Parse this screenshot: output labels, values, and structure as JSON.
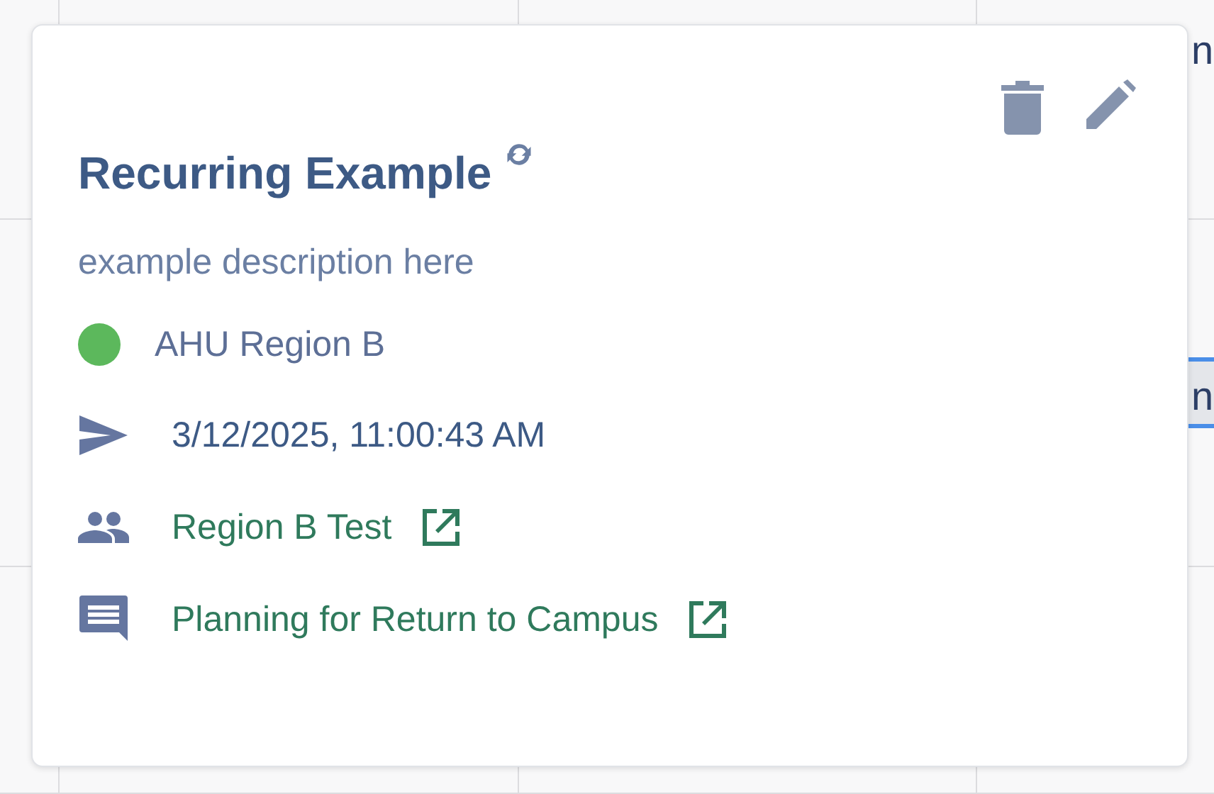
{
  "calendar": {
    "cell_text": "n",
    "event": {
      "title": "n"
    }
  },
  "popover": {
    "title": "Recurring Example",
    "recurring": true,
    "description": "example description here",
    "location": {
      "name": "AHU Region B",
      "color": "#5cb85c"
    },
    "details": [
      {
        "kind": "sent",
        "text": "3/12/2025, 11:00:43 AM",
        "link": false
      },
      {
        "kind": "group",
        "text": "Region B Test",
        "link": true
      },
      {
        "kind": "chat",
        "text": "Planning for Return to Campus",
        "link": true
      }
    ]
  }
}
